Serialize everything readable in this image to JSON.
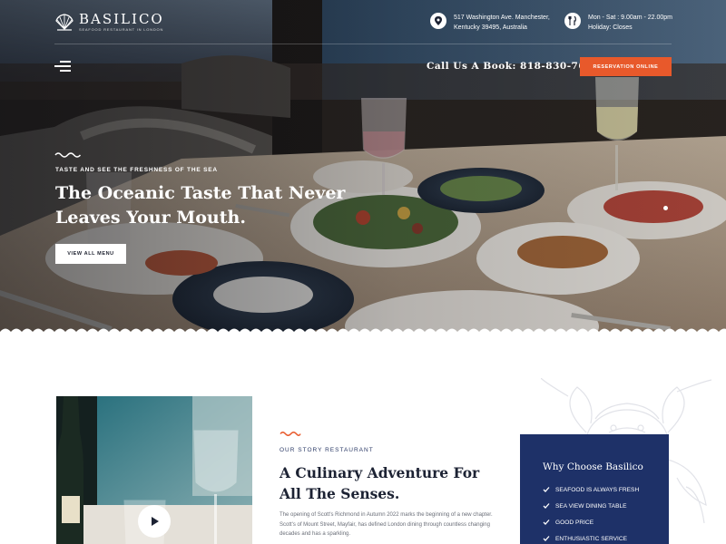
{
  "brand": {
    "name": "BASILICO",
    "tagline": "SEAFOOD RESTAURANT IN LONDON"
  },
  "header": {
    "address_line1": "517 Washington Ave. Manchester,",
    "address_line2": "Kentucky 39495, Australia",
    "hours_line1": "Mon - Sat : 9.00am - 22.00pm",
    "hours_line2": "Holiday: Closes",
    "address_icon": "location-pin-icon",
    "hours_icon": "cutlery-icon",
    "call_text": "Call Us A Book: 818-830-7648",
    "reservation_label": "RESERVATION ONLINE"
  },
  "hero": {
    "eyebrow": "TASTE AND SEE THE FRESHNESS OF THE SEA",
    "title": "The Oceanic Taste That Never Leaves Your Mouth.",
    "button_label": "VIEW ALL MENU"
  },
  "story": {
    "eyebrow": "OUR STORY RESTAURANT",
    "title": "A Culinary Adventure For All The Senses.",
    "description": "The opening of Scott's Richmond in Autumn 2022 marks the beginning of a new chapter. Scott's of Mount Street, Mayfair, has defined London dining through countless changing decades and has a sparkling.",
    "play_icon": "play-icon"
  },
  "why": {
    "title": "Why Choose Basilico",
    "items": [
      "SEAFOOD IS ALWAYS FRESH",
      "SEA VIEW DINING TABLE",
      "GOOD PRICE",
      "ENTHUSIASTIC SERVICE"
    ]
  },
  "colors": {
    "accent": "#e8592b",
    "navy": "#1e3168",
    "heading": "#1c2233"
  }
}
